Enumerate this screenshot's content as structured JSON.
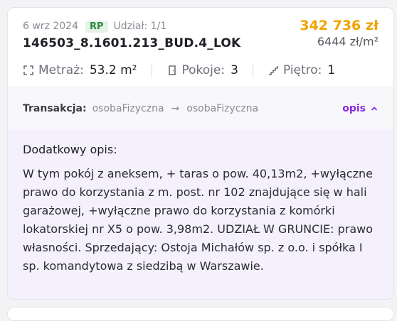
{
  "listing": {
    "date": "6 wrz 2024",
    "badge": "RP",
    "share": "Udział: 1/1",
    "code": "146503_8.1601.213_BUD.4_LOK",
    "price_total": "342 736 zł",
    "price_per_m2": "6444 zł/m²",
    "stats": {
      "area_label": "Metraż:",
      "area_value": "53.2 m²",
      "rooms_label": "Pokoje:",
      "rooms_value": "3",
      "floor_label": "Piętro:",
      "floor_value": "1"
    }
  },
  "transaction": {
    "label": "Transakcja:",
    "from": "osobaFizyczna",
    "arrow": "→",
    "to": "osobaFizyczna",
    "toggle_label": "opis"
  },
  "description": {
    "title": "Dodatkowy opis:",
    "text": "W tym pokój z aneksem, + taras o pow. 40,13m2, +wyłączne prawo do korzystania z m. post. nr 102 znajdujące się w hali garażowej, +wyłączne prawo do korzystania z komórki lokatorskiej nr X5 o pow. 3,98m2. UDZIAŁ W GRUNCIE: prawo własności. Sprzedający: Ostoja Michałów sp. z o.o. i spółka I sp. komandytowa z siedzibą w Warszawie."
  },
  "colors": {
    "price": "#f2a300",
    "accent": "#8a2be2",
    "badge_bg": "#e4f3e6",
    "badge_text": "#2d8a44",
    "description_bg": "#f5f1fc"
  },
  "icons": {
    "area": "expand-corners-icon",
    "rooms": "door-icon",
    "floor": "stairs-icon",
    "toggle": "chevron-up-icon"
  }
}
